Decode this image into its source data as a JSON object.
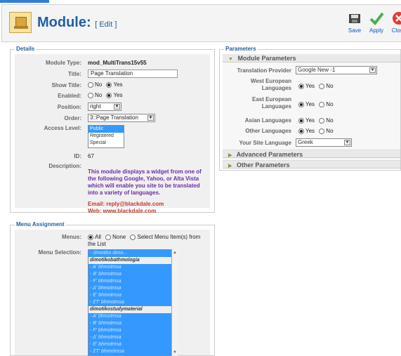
{
  "header": {
    "title": "Module:",
    "subtitle": "[ Edit ]",
    "buttons": [
      {
        "label": "Save",
        "icon": "save-icon"
      },
      {
        "label": "Apply",
        "icon": "apply-icon"
      },
      {
        "label": "Close",
        "icon": "close-icon"
      }
    ]
  },
  "details": {
    "legend": "Details",
    "module_type": {
      "label": "Module Type:",
      "value": "mod_MultiTrans15v55"
    },
    "title": {
      "label": "Title:",
      "value": "Page Translation"
    },
    "show_title": {
      "label": "Show Title:",
      "options": [
        "No",
        "Yes"
      ],
      "selected": "Yes"
    },
    "enabled": {
      "label": "Enabled:",
      "options": [
        "No",
        "Yes"
      ],
      "selected": "Yes"
    },
    "position": {
      "label": "Position:",
      "value": "right"
    },
    "order": {
      "label": "Order:",
      "value": "3::Page Translation"
    },
    "access": {
      "label": "Access Level:",
      "options": [
        "Public",
        "Registered",
        "Special"
      ],
      "selected": "Public"
    },
    "id": {
      "label": "ID:",
      "value": "67"
    },
    "description": {
      "label": "Description:",
      "text": "This module displays a widget from one of the following Google, Yahoo, or Alta Vista which will enable you site to be translated into a variety of languages.",
      "email": "Email: reply@blackdale.com",
      "web": "Web: www.blackdale.com"
    }
  },
  "menu": {
    "legend": "Menu Assignment",
    "menus": {
      "label": "Menus:",
      "options": [
        "All",
        "None",
        "Select Menu Item(s) from the List"
      ],
      "selected": "All"
    },
    "selection": {
      "label": "Menu Selection:",
      "items": [
        {
          "text": "- dimotiko dimo...",
          "type": "opt"
        },
        {
          "text": "dimotikobathmologia",
          "type": "grp"
        },
        {
          "text": "- A' bhmotmsa",
          "type": "opt"
        },
        {
          "text": "- B' bhmotmsa",
          "type": "opt"
        },
        {
          "text": "- F' bhmotmsa",
          "type": "opt"
        },
        {
          "text": "- Δ' bhmotmsa",
          "type": "opt"
        },
        {
          "text": "- E' bhmotmsa",
          "type": "opt"
        },
        {
          "text": "- ΣT' bhmotmsa",
          "type": "opt"
        },
        {
          "text": "dimotikostudymaterial",
          "type": "grp"
        },
        {
          "text": "- A' bhmotmsa",
          "type": "opt"
        },
        {
          "text": "- B' bhmotmsa",
          "type": "opt"
        },
        {
          "text": "- F' bhmotmsa",
          "type": "opt"
        },
        {
          "text": "- Δ' bhmotmsa",
          "type": "opt"
        },
        {
          "text": "- E' bhmotmsa",
          "type": "opt"
        },
        {
          "text": "- ΣT' bhmotmsa",
          "type": "opt"
        }
      ]
    }
  },
  "parameters": {
    "legend": "Parameters",
    "module_parameters": "Module Parameters",
    "translation_provider": {
      "label": "Translation Provider",
      "value": "Google New -1"
    },
    "west": {
      "label": "West European Languages",
      "options": [
        "Yes",
        "No"
      ],
      "selected": "Yes"
    },
    "east": {
      "label": "East European Languages",
      "options": [
        "Yes",
        "No"
      ],
      "selected": "Yes"
    },
    "asian": {
      "label": "Asian Languages",
      "options": [
        "Yes",
        "No"
      ],
      "selected": "Yes"
    },
    "other": {
      "label": "Other Languages",
      "options": [
        "Yes",
        "No"
      ],
      "selected": "Yes"
    },
    "site_language": {
      "label": "Your Site Language",
      "value": "Greek"
    },
    "advanced": "Advanced Parameters",
    "other_params": "Other Parameters"
  }
}
